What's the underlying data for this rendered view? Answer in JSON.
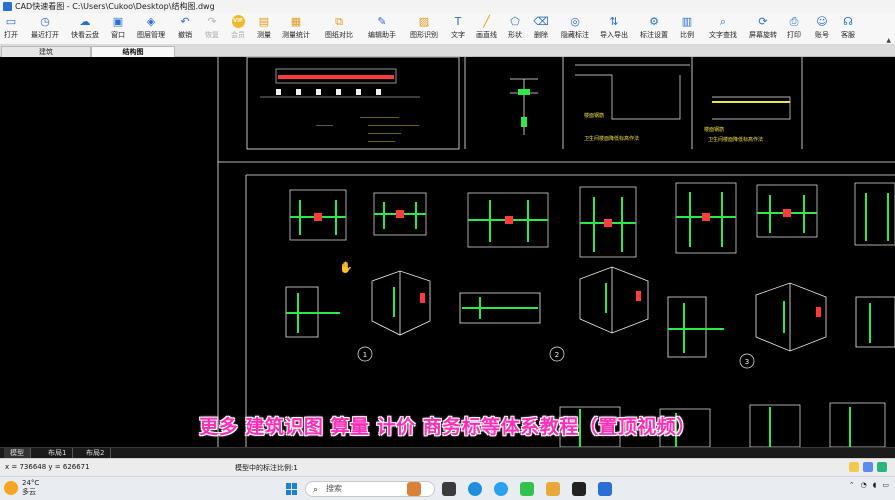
{
  "window": {
    "title": "CAD快速看图 - C:\\Users\\Cukoo\\Desktop\\结构图.dwg"
  },
  "toolbar": {
    "items": [
      {
        "label": "打开",
        "icon": "folder-open-icon",
        "enabled": true
      },
      {
        "label": "最近打开",
        "icon": "clock-icon",
        "enabled": true
      },
      {
        "label": "快看云盘",
        "icon": "cloud-icon",
        "enabled": true
      },
      {
        "label": "窗口",
        "icon": "window-icon",
        "enabled": true
      },
      {
        "label": "图层管理",
        "icon": "layers-icon",
        "enabled": true
      },
      {
        "label": "撤销",
        "icon": "undo-icon",
        "enabled": true
      },
      {
        "label": "恢复",
        "icon": "redo-icon",
        "enabled": false
      },
      {
        "label": "会员",
        "icon": "vip-icon",
        "enabled": false
      },
      {
        "label": "测量",
        "icon": "measure-icon",
        "enabled": true
      },
      {
        "label": "测量统计",
        "icon": "measure-stats-icon",
        "enabled": true
      },
      {
        "label": "图纸对比",
        "icon": "compare-icon",
        "enabled": true
      },
      {
        "label": "编辑助手",
        "icon": "edit-assistant-icon",
        "enabled": true
      },
      {
        "label": "图形识别",
        "icon": "shape-recognition-icon",
        "enabled": true
      },
      {
        "label": "文字",
        "icon": "text-icon",
        "enabled": true
      },
      {
        "label": "画直线",
        "icon": "line-icon",
        "enabled": true
      },
      {
        "label": "形状",
        "icon": "shape-icon",
        "enabled": true
      },
      {
        "label": "删除",
        "icon": "eraser-icon",
        "enabled": true
      },
      {
        "label": "隐藏标注",
        "icon": "hide-annotation-icon",
        "enabled": true
      },
      {
        "label": "导入导出",
        "icon": "import-export-icon",
        "enabled": true
      },
      {
        "label": "标注设置",
        "icon": "annotation-settings-icon",
        "enabled": true
      },
      {
        "label": "比例",
        "icon": "scale-icon",
        "enabled": true
      },
      {
        "label": "文字查找",
        "icon": "text-search-icon",
        "enabled": true
      },
      {
        "label": "屏幕旋转",
        "icon": "rotate-screen-icon",
        "enabled": true
      },
      {
        "label": "打印",
        "icon": "print-icon",
        "enabled": true
      },
      {
        "label": "账号",
        "icon": "account-icon",
        "enabled": true
      },
      {
        "label": "客服",
        "icon": "headset-icon",
        "enabled": true
      }
    ]
  },
  "doc_tabs": [
    {
      "label": "建筑",
      "active": false
    },
    {
      "label": "结构图",
      "active": true
    }
  ],
  "drawing": {
    "labels": {
      "pit_label": "卫生间楼面降低标高作法",
      "pit_label_2": "卫生间楼面降低标高作法",
      "floor_label": "楼面钢筋",
      "floor_label_2": "楼面钢筋"
    },
    "circle_markers": [
      "1",
      "2",
      "3"
    ]
  },
  "overlay": {
    "subtitle": "更多 建筑识图 算量 计价 商务标等体系教程（置顶视频）"
  },
  "layout_tabs": [
    {
      "label": "模型",
      "active": true
    },
    {
      "label": "布局1",
      "active": false
    },
    {
      "label": "布局2",
      "active": false
    }
  ],
  "status": {
    "coords": "x = 736648  y = 626671",
    "scale_text": "模型中的标注比例:1"
  },
  "taskbar": {
    "weather_temp": "24°C",
    "weather_desc": "多云",
    "search_placeholder": "搜索"
  },
  "colors": {
    "canvas_bg": "#000000",
    "drawing_white": "#f0f0f0",
    "drawing_green": "#2ee84a",
    "drawing_red": "#ff3b3b",
    "drawing_yellow": "#f0e04a",
    "subtitle_color": "#ff2fb7",
    "accent": "#2a6fd6"
  }
}
